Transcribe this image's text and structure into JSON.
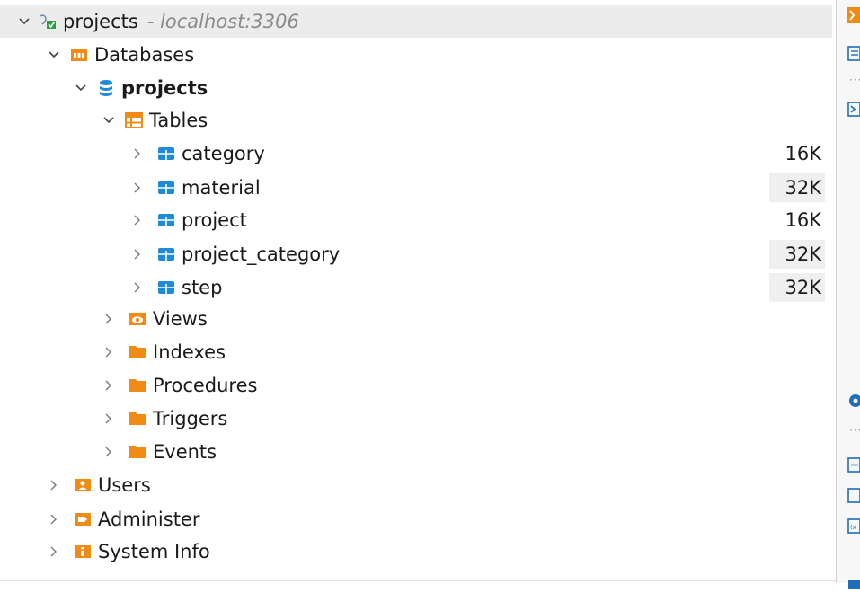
{
  "tree": {
    "connection": {
      "label": "projects",
      "host": "- localhost:3306"
    },
    "databases_label": "Databases",
    "schema_label": "projects",
    "tables_label": "Tables",
    "tables": [
      {
        "name": "category",
        "size": "16K"
      },
      {
        "name": "material",
        "size": "32K"
      },
      {
        "name": "project",
        "size": "16K"
      },
      {
        "name": "project_category",
        "size": "32K"
      },
      {
        "name": "step",
        "size": "32K"
      }
    ],
    "folders": [
      "Views",
      "Indexes",
      "Procedures",
      "Triggers",
      "Events"
    ],
    "root_items": [
      "Users",
      "Administer",
      "System Info"
    ]
  },
  "icons": {
    "connection": "mysql-connection-icon",
    "databases": "databases-folder-icon",
    "schema": "database-icon",
    "tables": "tables-folder-icon",
    "table": "table-icon",
    "views": "views-folder-icon",
    "folder": "folder-icon",
    "users": "users-icon",
    "administer": "administer-icon",
    "system_info": "system-info-icon"
  },
  "colors": {
    "folder": "#f08c16",
    "table": "#1f8ad6",
    "database": "#1f8ad6",
    "selection": "#ececec"
  }
}
